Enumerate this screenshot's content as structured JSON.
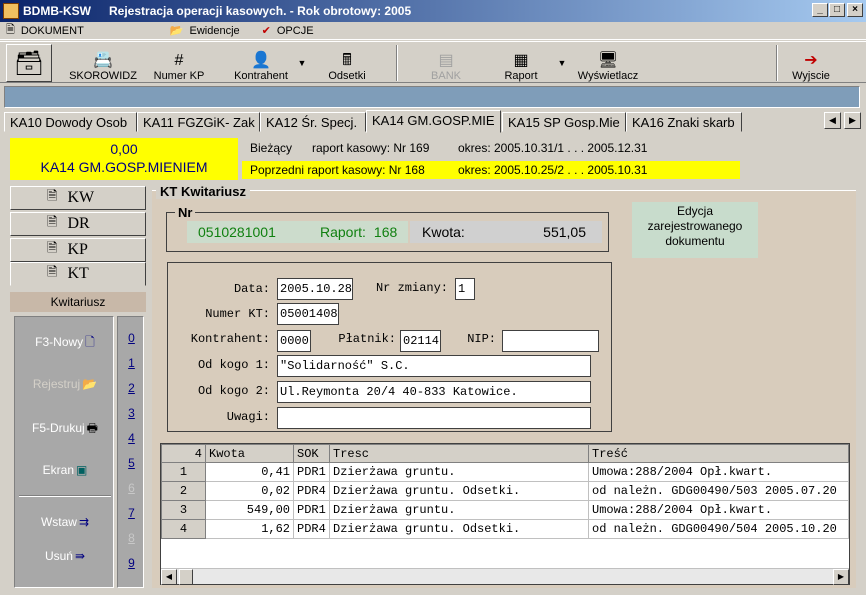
{
  "window": {
    "app_name": "BDMB-KSW",
    "title": "Rejestracja operacji kasowych.  - Rok obrotowy: 2005",
    "min": "_",
    "max": "□",
    "close": "×"
  },
  "menu": [
    {
      "label": "DOKUMENT",
      "icon": "document-icon"
    },
    {
      "label": "Ewidencje",
      "icon": "folder-open-icon"
    },
    {
      "label": "OPCJE",
      "icon": "checkmark-icon"
    }
  ],
  "toolbar": {
    "skorowidz": "SKOROWIDZ",
    "numer_kp": "Numer KP",
    "kontrahent": "Kontrahent",
    "odsetki": "Odsetki",
    "bank": "BANK",
    "raport": "Raport",
    "wyswietlacz": "Wyświetlacz",
    "wyjscie": "Wyjscie"
  },
  "tabs": [
    "KA10 Dowody Osob",
    "KA11 FGZGiK- Zak",
    "KA12 Śr. Specj.",
    "KA14 GM.GOSP.MIE",
    "KA15 SP Gosp.Mie",
    "KA16 Znaki skarb"
  ],
  "active_tab": "KA14 GM.GOSP.MIE",
  "balance": {
    "amount": "0,00",
    "name": "KA14 GM.GOSP.MIENIEM"
  },
  "reports": {
    "current": {
      "label": "Bieżący",
      "raport": "raport kasowy: Nr 169",
      "okres": "okres:  2005.10.31/1 . . . 2005.12.31"
    },
    "previous": {
      "raport": "Poprzedni raport kasowy: Nr 168",
      "okres": "okres:  2005.10.25/2 . . . 2005.10.31"
    }
  },
  "nav": [
    {
      "label": "KW",
      "underline": "W",
      "rest": "K"
    },
    {
      "label": "DR",
      "underline": "R",
      "rest": "D"
    },
    {
      "label": "KP",
      "underline": "P",
      "rest": "K"
    },
    {
      "label": "KT",
      "underline": "T",
      "rest": "K"
    }
  ],
  "section_label": "Kwitariusz",
  "actions": {
    "nowy": "F3-Nowy",
    "rejestruj": "Rejestruj",
    "drukuj": "F5-Drukuj",
    "ekran": "Ekran",
    "wstaw": "Wstaw",
    "usun": "Usuń"
  },
  "numbers": [
    "0",
    "1",
    "2",
    "3",
    "4",
    "5",
    "6",
    "7",
    "8",
    "9"
  ],
  "kt_header": "KT  Kwitariusz",
  "nr": {
    "label": "Nr",
    "number": "0510281001",
    "raport_label": "Raport:",
    "raport": "168",
    "kwota_label": "Kwota:",
    "kwota": "551,05"
  },
  "edycja": "Edycja zarejestrowanego dokumentu",
  "form": {
    "data_label": "Data:",
    "data": "2005.10.28",
    "nr_zmiany_label": "Nr zmiany:",
    "nr_zmiany": "1",
    "numer_kt_label": "Numer KT:",
    "numer_kt": "05001408",
    "kontrahent_label": "Kontrahent:",
    "kontrahent": "0000",
    "platnik_label": "Płatnik:",
    "platnik": "02114",
    "nip_label": "NIP:",
    "nip": "",
    "od_kogo1_label": "Od kogo 1:",
    "od_kogo1": "\"Solidarność\" S.C.",
    "od_kogo2_label": "Od kogo 2:",
    "od_kogo2": "Ul.Reymonta 20/4 40-833 Katowice.",
    "uwagi_label": "Uwagi:",
    "uwagi": ""
  },
  "grid": {
    "headers": [
      "4",
      "Kwota",
      "SOK",
      "Tresc",
      "Treść"
    ],
    "rows": [
      [
        "1",
        "0,41",
        "PDR1",
        "Dzierżawa gruntu.",
        "Umowa:288/2004 Opł.kwart."
      ],
      [
        "2",
        "0,02",
        "PDR4",
        "Dzierżawa gruntu. Odsetki.",
        "od należn. GDG00490/503 2005.07.20"
      ],
      [
        "3",
        "549,00",
        "PDR1",
        "Dzierżawa gruntu.",
        "Umowa:288/2004 Opł.kwart."
      ],
      [
        "4",
        "1,62",
        "PDR4",
        "Dzierżawa gruntu. Odsetki.",
        "od należn. GDG00490/504 2005.10.20"
      ]
    ]
  }
}
